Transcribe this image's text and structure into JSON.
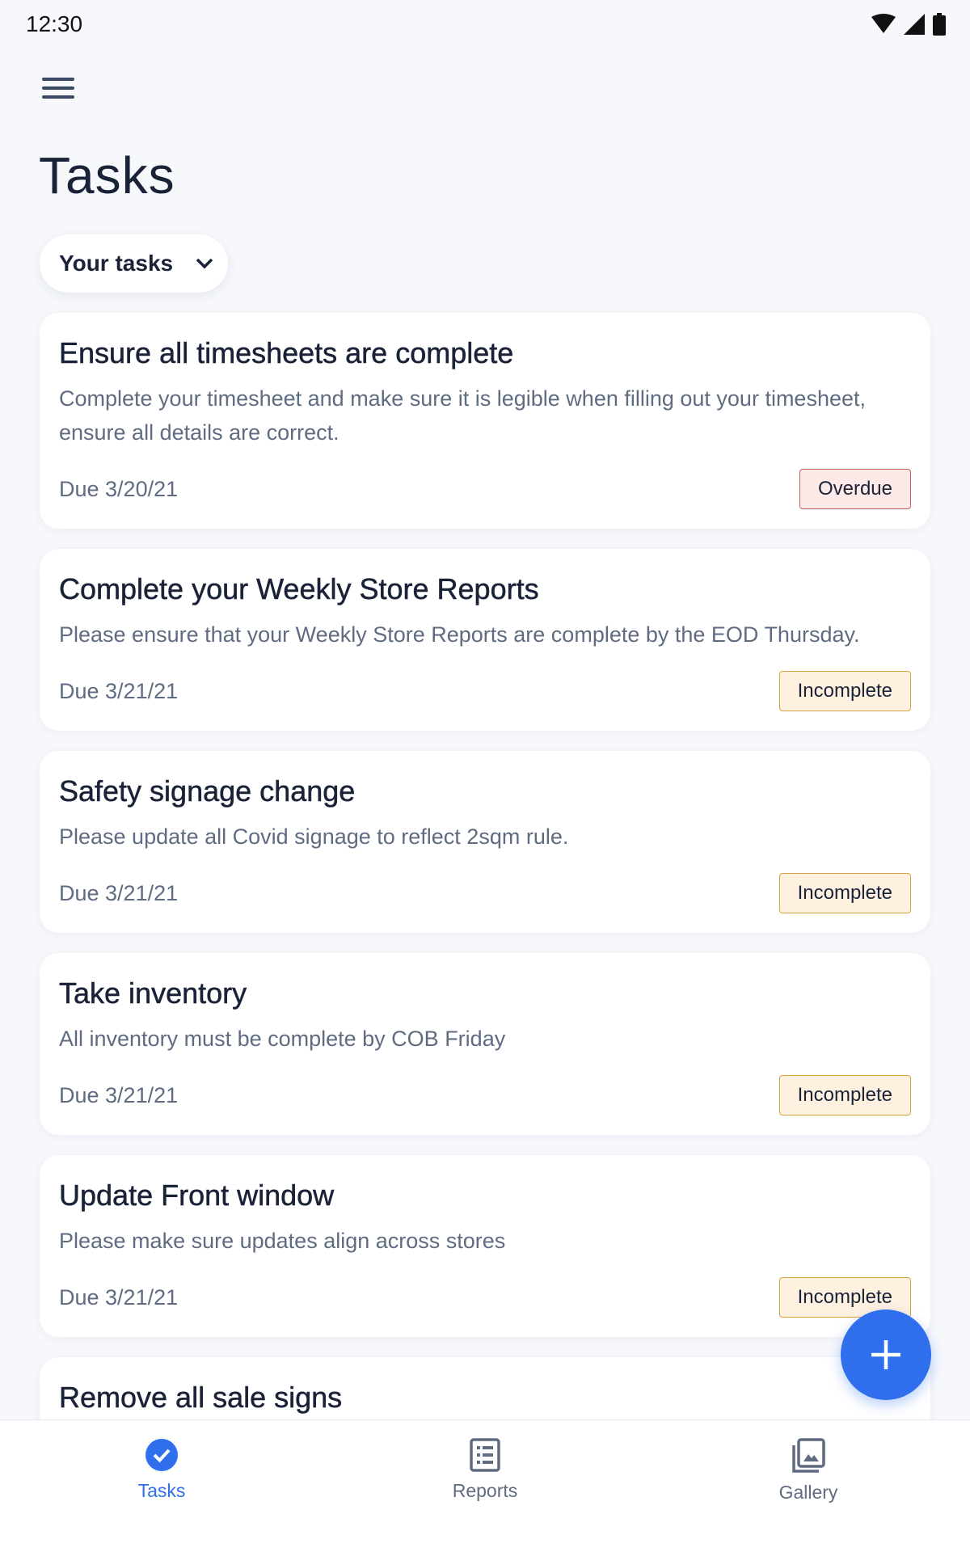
{
  "status_bar": {
    "time": "12:30",
    "icons": [
      "wifi-icon",
      "signal-icon",
      "battery-icon"
    ]
  },
  "header": {
    "menu_icon": "hamburger-menu-icon",
    "title": "Tasks"
  },
  "filter": {
    "selected": "Your tasks",
    "icon": "chevron-down-icon"
  },
  "tasks": [
    {
      "title": "Ensure all timesheets are complete",
      "description": "Complete your timesheet and make sure it is legible when filling out your timesheet, ensure all details are correct.",
      "due": "Due 3/20/21",
      "status": "Overdue",
      "status_type": "overdue"
    },
    {
      "title": "Complete your Weekly Store Reports",
      "description": "Please ensure that your Weekly Store Reports are complete by the EOD Thursday.",
      "due": "Due 3/21/21",
      "status": "Incomplete",
      "status_type": "incomplete"
    },
    {
      "title": "Safety signage change",
      "description": "Please update all Covid signage to reflect 2sqm rule.",
      "due": "Due 3/21/21",
      "status": "Incomplete",
      "status_type": "incomplete"
    },
    {
      "title": "Take inventory",
      "description": "All inventory must be complete by COB Friday",
      "due": "Due 3/21/21",
      "status": "Incomplete",
      "status_type": "incomplete"
    },
    {
      "title": "Update Front window",
      "description": "Please make sure updates align across stores",
      "due": "Due 3/21/21",
      "status": "Incomplete",
      "status_type": "incomplete"
    },
    {
      "title": "Remove all sale signs"
    }
  ],
  "fab": {
    "icon": "plus-icon"
  },
  "bottom_nav": [
    {
      "label": "Tasks",
      "icon": "check-circle-icon",
      "active": true
    },
    {
      "label": "Reports",
      "icon": "list-document-icon",
      "active": false
    },
    {
      "label": "Gallery",
      "icon": "gallery-icon",
      "active": false
    }
  ],
  "colors": {
    "accent": "#2f6fed",
    "overdue_border": "#c95c5c",
    "overdue_bg": "#fde9e8",
    "incomplete_border": "#d9a33b",
    "incomplete_bg": "#fef1e0",
    "background": "#f6f8fc"
  }
}
